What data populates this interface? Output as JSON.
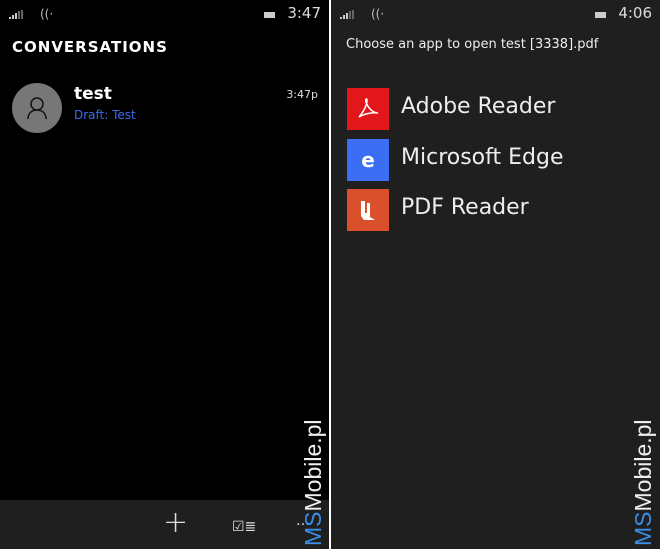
{
  "left": {
    "status": {
      "time": "3:47"
    },
    "title": "CONVERSATIONS",
    "conversation": {
      "name": "test",
      "draft": "Draft: Test",
      "time": "3:47p"
    },
    "appbar": {
      "new": "+",
      "select": "☑≣",
      "more": "…"
    }
  },
  "right": {
    "status": {
      "time": "4:06"
    },
    "prompt": "Choose an app to open test [3338].pdf",
    "apps": [
      {
        "name": "Adobe Reader",
        "color": "#e2171b",
        "glyph": "A"
      },
      {
        "name": "Microsoft Edge",
        "color": "#3b6ef5",
        "glyph": "e"
      },
      {
        "name": "PDF Reader",
        "color": "#d9502b",
        "glyph": "▥"
      }
    ]
  },
  "watermark": {
    "ms": "MS",
    "rest": "Mobile.pl"
  }
}
